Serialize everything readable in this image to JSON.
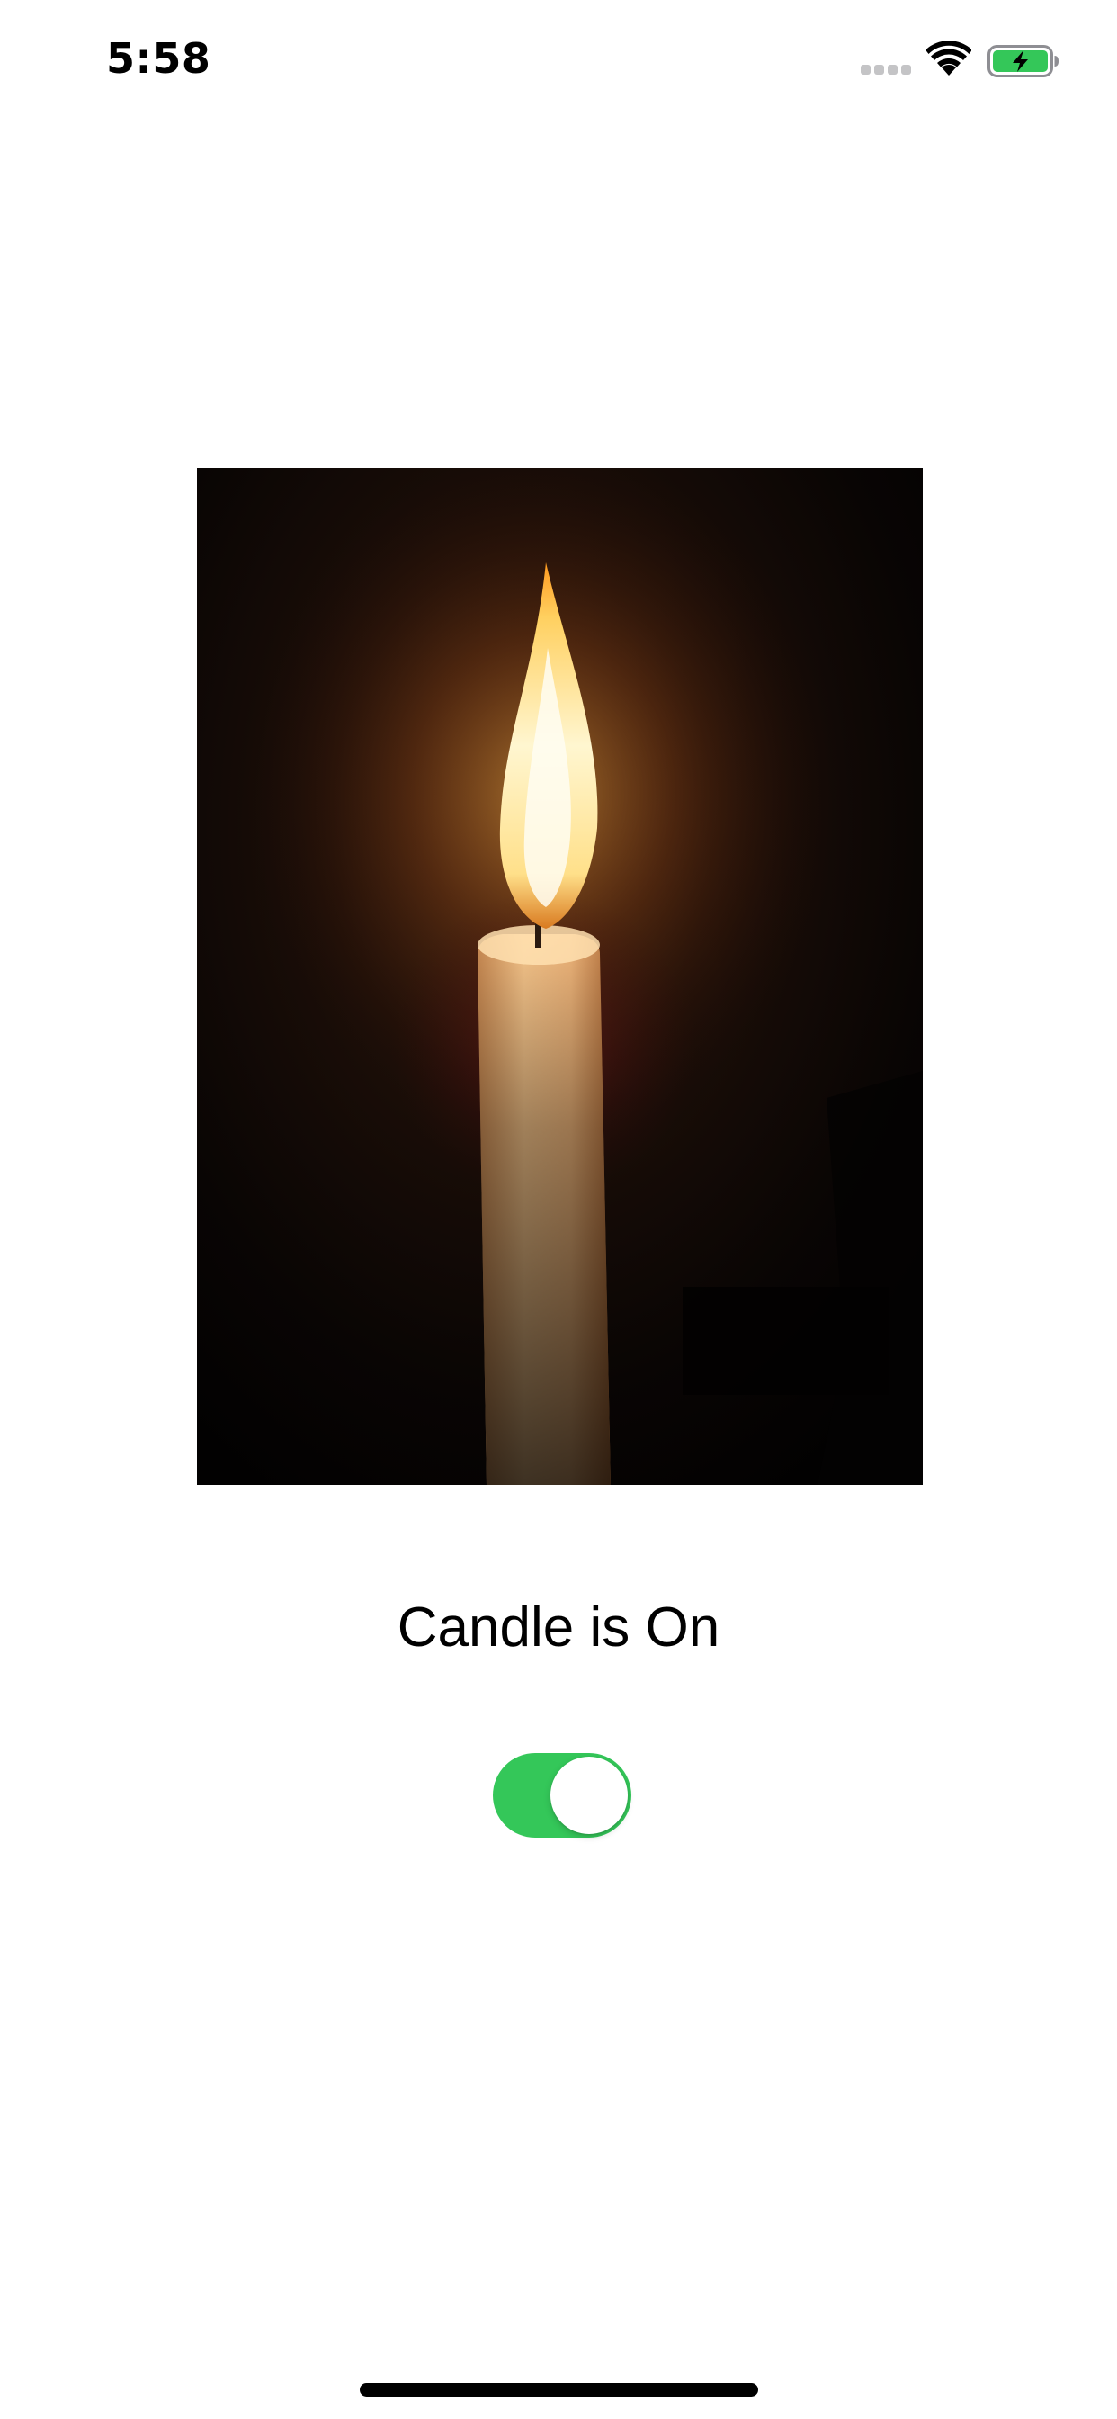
{
  "status_bar": {
    "time": "5:58",
    "signal_icon": "cellular-signal-icon",
    "wifi_icon": "wifi-icon",
    "battery_icon": "battery-charging-icon",
    "battery_color": "#34c759"
  },
  "candle": {
    "image_icon": "candle-photo",
    "status_text": "Candle is On",
    "toggle_on": true,
    "toggle_color": "#34c759"
  }
}
